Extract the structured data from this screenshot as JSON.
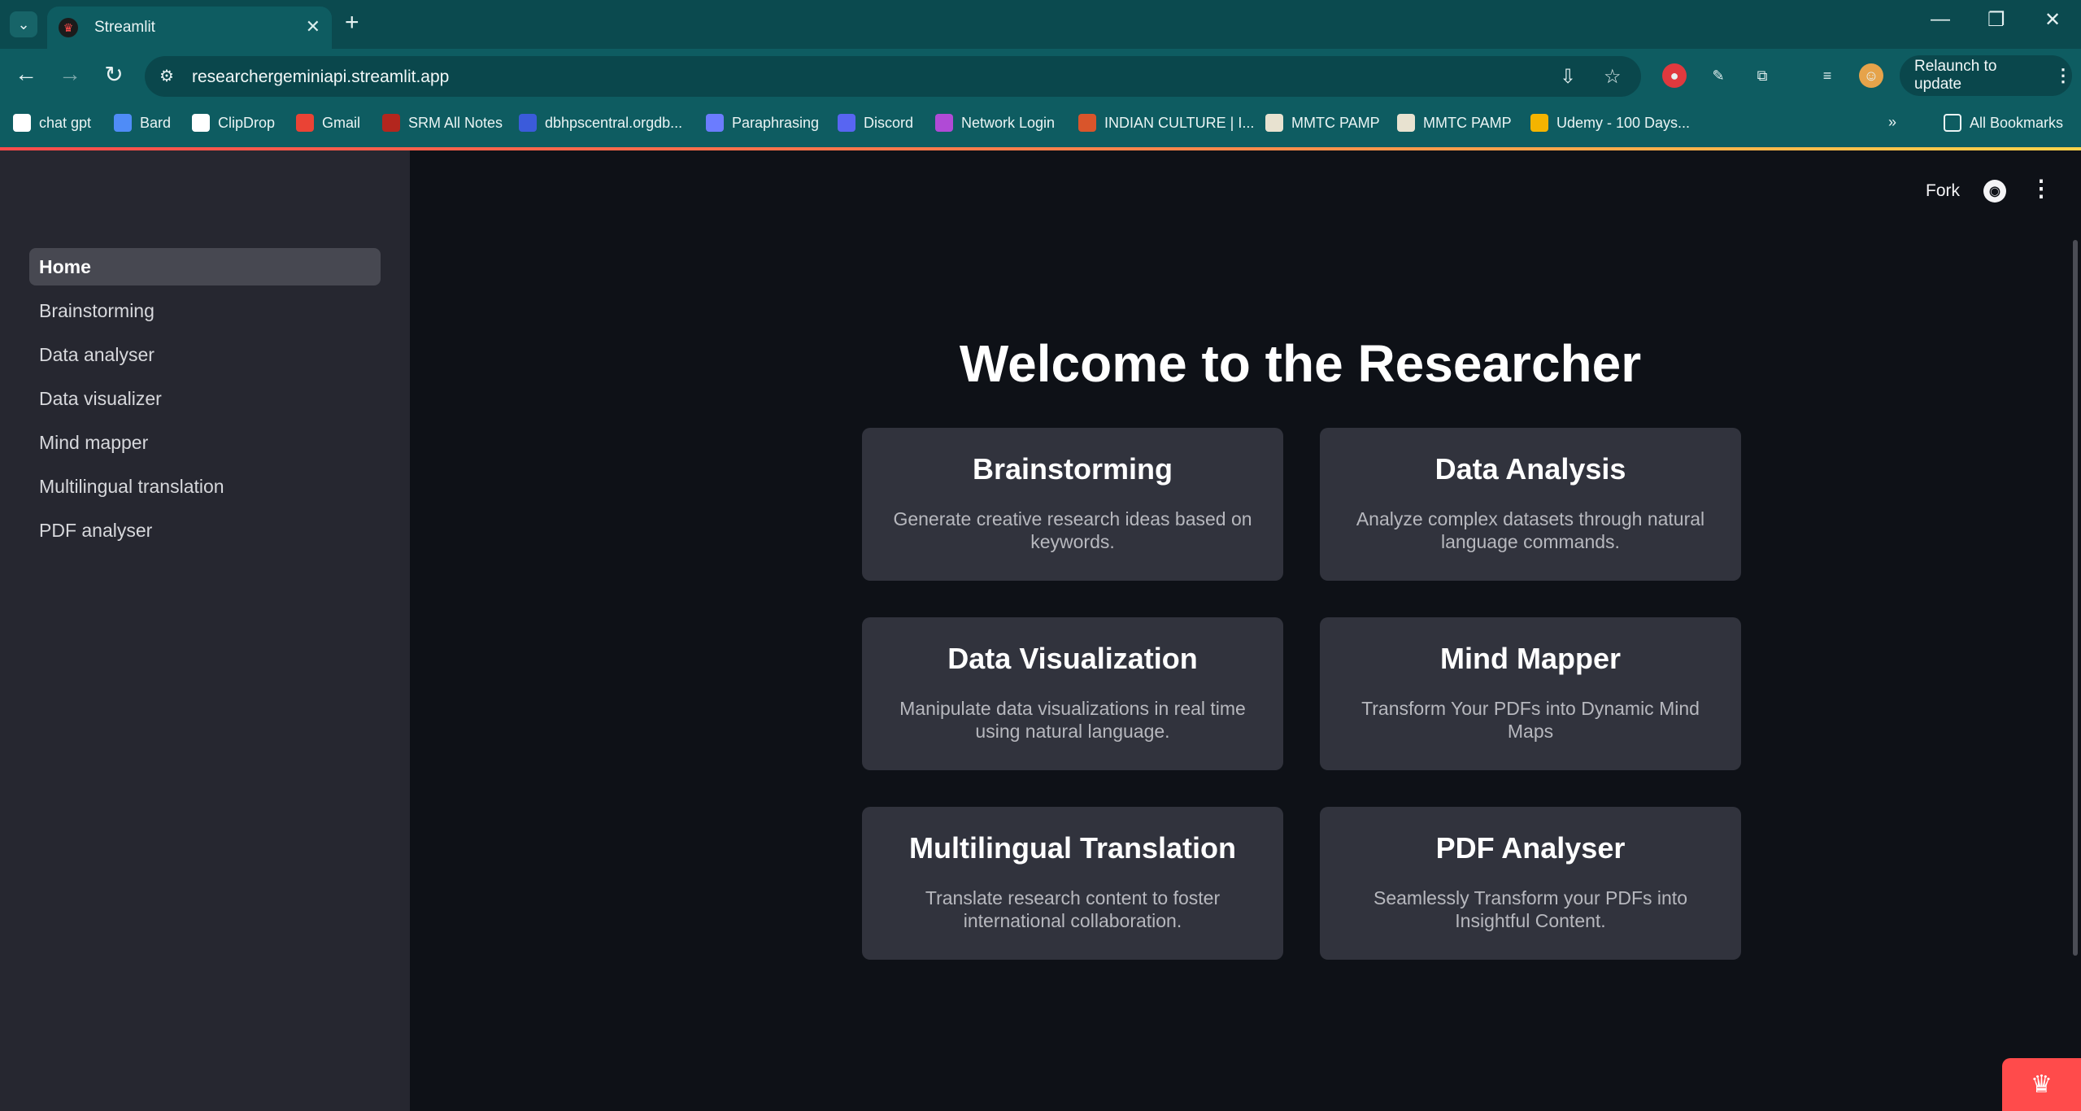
{
  "browser": {
    "tab_title": "Streamlit",
    "url": "researchergeminiapi.streamlit.app",
    "relaunch_label": "Relaunch to update",
    "all_bookmarks_label": "All Bookmarks",
    "bookmarks": [
      {
        "label": "chat gpt",
        "icon": "openai-icon",
        "color": "#ffffff"
      },
      {
        "label": "Bard",
        "icon": "sparkle-icon",
        "color": "#4f8cf7"
      },
      {
        "label": "ClipDrop",
        "icon": "clipdrop-icon",
        "color": "#ffffff"
      },
      {
        "label": "Gmail",
        "icon": "gmail-icon",
        "color": "#ea4335"
      },
      {
        "label": "SRM All Notes",
        "icon": "srm-icon",
        "color": "#b3261e"
      },
      {
        "label": "dbhpscentral.orgdb...",
        "icon": "grid-icon",
        "color": "#3b5bdb"
      },
      {
        "label": "Paraphrasing",
        "icon": "glasses-icon",
        "color": "#6b7cff"
      },
      {
        "label": "Discord",
        "icon": "discord-icon",
        "color": "#5865f2"
      },
      {
        "label": "Network Login",
        "icon": "umbrella-icon",
        "color": "#b04ad6"
      },
      {
        "label": "INDIAN CULTURE | I...",
        "icon": "culture-icon",
        "color": "#d9552b"
      },
      {
        "label": "MMTC PAMP",
        "icon": "mmtc-icon",
        "color": "#e8e2d0"
      },
      {
        "label": "MMTC PAMP",
        "icon": "mmtc-icon",
        "color": "#e8e2d0"
      },
      {
        "label": "Udemy - 100 Days...",
        "icon": "drive-icon",
        "color": "#f4b400"
      }
    ]
  },
  "sidebar": {
    "items": [
      {
        "label": "Home",
        "active": true
      },
      {
        "label": "Brainstorming",
        "active": false
      },
      {
        "label": "Data analyser",
        "active": false
      },
      {
        "label": "Data visualizer",
        "active": false
      },
      {
        "label": "Mind mapper",
        "active": false
      },
      {
        "label": "Multilingual translation",
        "active": false
      },
      {
        "label": "PDF analyser",
        "active": false
      }
    ]
  },
  "header": {
    "fork_label": "Fork"
  },
  "main": {
    "title": "Welcome to the Researcher",
    "cards": [
      {
        "title": "Brainstorming",
        "description": "Generate creative research ideas based on keywords."
      },
      {
        "title": "Data Analysis",
        "description": "Analyze complex datasets through natural language commands."
      },
      {
        "title": "Data Visualization",
        "description": "Manipulate data visualizations in real time using natural language."
      },
      {
        "title": "Mind Mapper",
        "description": "Transform Your PDFs into Dynamic Mind Maps"
      },
      {
        "title": "Multilingual Translation",
        "description": "Translate research content to foster international collaboration."
      },
      {
        "title": "PDF Analyser",
        "description": "Seamlessly Transform your PDFs into Insightful Content."
      }
    ]
  },
  "colors": {
    "accent": "#ff4b4b",
    "sidebar_bg": "#262730",
    "main_bg": "#0e1117",
    "card_bg": "#31333d",
    "chrome_bg": "#0e5c61"
  }
}
